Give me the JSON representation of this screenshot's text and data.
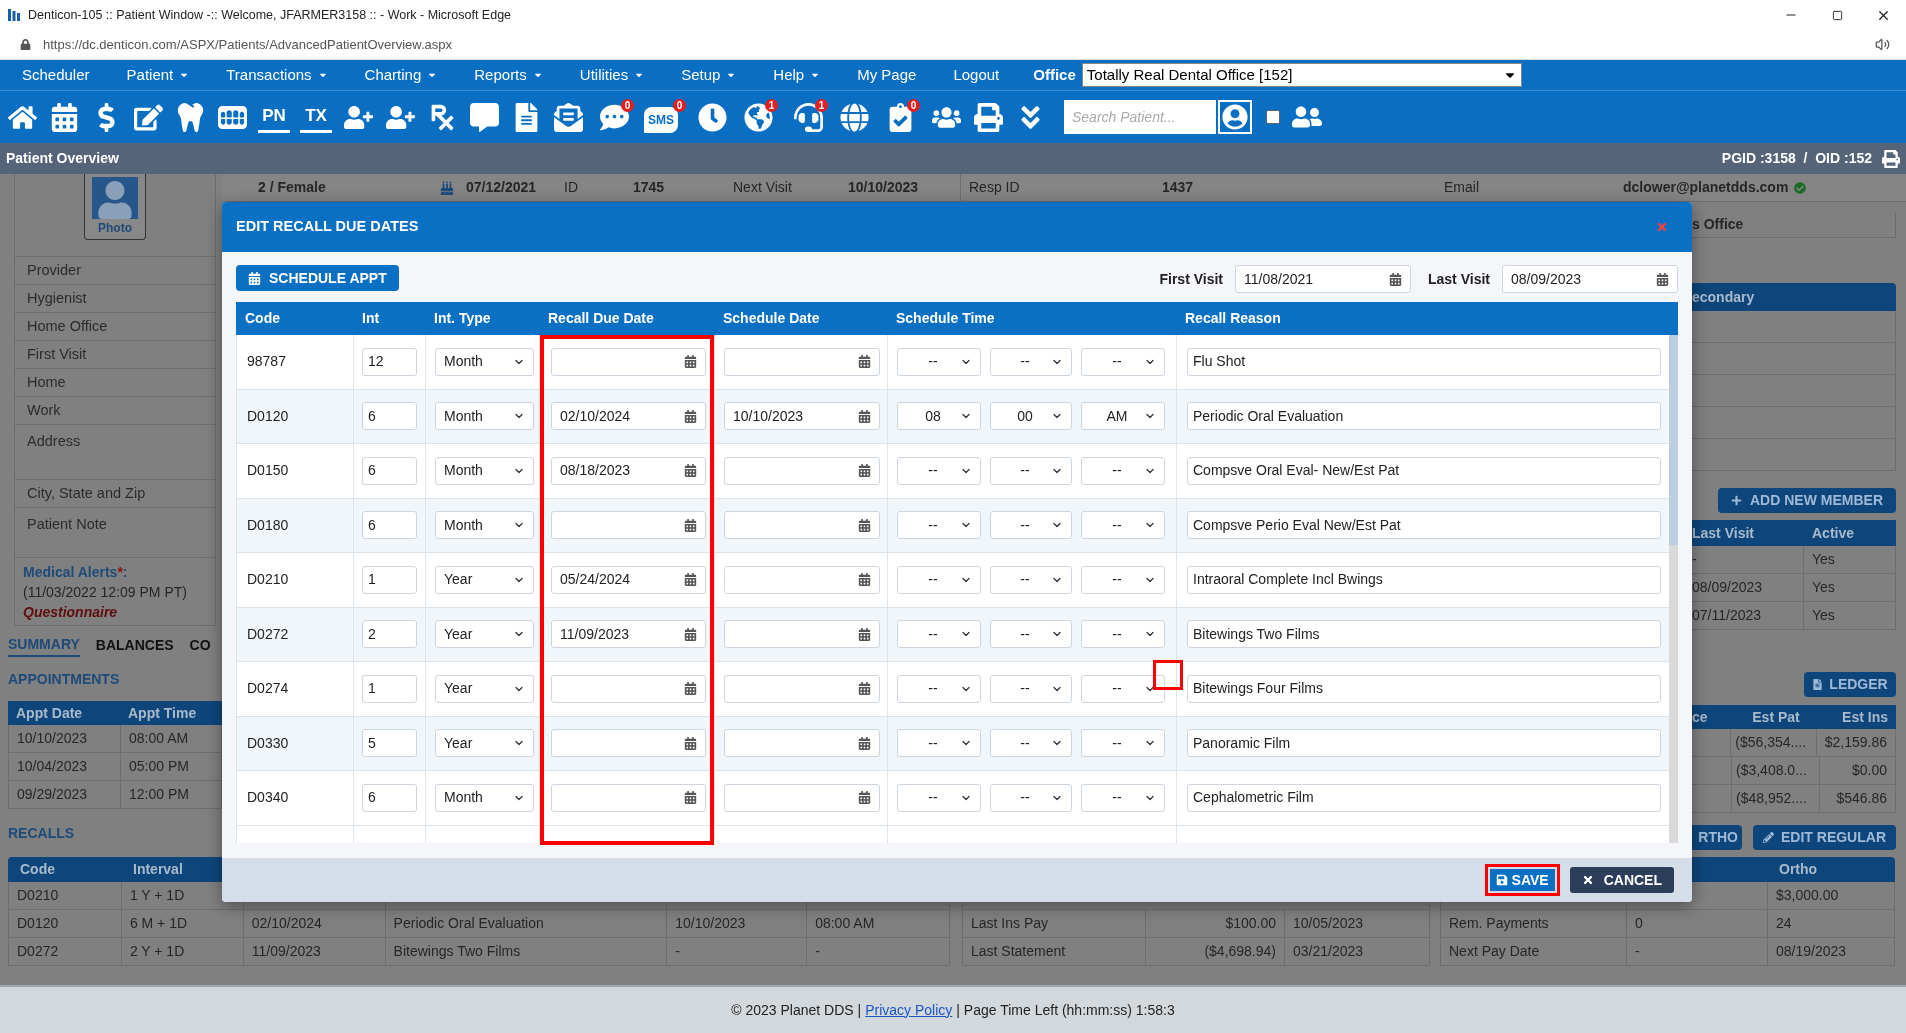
{
  "browser": {
    "title": "Denticon-105 :: Patient Window -:: Welcome, JFARMER3158 :: - Work - Microsoft Edge",
    "url": "https://dc.denticon.com/ASPX/Patients/AdvancedPatientOverview.aspx"
  },
  "menu": {
    "items": [
      {
        "label": "Scheduler",
        "dropdown": false
      },
      {
        "label": "Patient",
        "dropdown": true
      },
      {
        "label": "Transactions",
        "dropdown": true
      },
      {
        "label": "Charting",
        "dropdown": true
      },
      {
        "label": "Reports",
        "dropdown": true
      },
      {
        "label": "Utilities",
        "dropdown": true
      },
      {
        "label": "Setup",
        "dropdown": true
      },
      {
        "label": "Help",
        "dropdown": true
      },
      {
        "label": "My Page",
        "dropdown": false
      },
      {
        "label": "Logout",
        "dropdown": false
      }
    ],
    "office_label": "Office",
    "office_value": "Totally Real Dental Office [152]"
  },
  "toolbar": {
    "items": [
      {
        "kind": "icon"
      },
      {
        "kind": "icon"
      },
      {
        "kind": "icon"
      },
      {
        "kind": "icon"
      },
      {
        "kind": "icon"
      },
      {
        "kind": "icon"
      },
      {
        "kind": "text",
        "label": "PN"
      },
      {
        "kind": "text",
        "label": "TX"
      },
      {
        "kind": "icon"
      },
      {
        "kind": "icon"
      },
      {
        "kind": "icon"
      },
      {
        "kind": "icon"
      },
      {
        "kind": "icon"
      },
      {
        "kind": "icon"
      },
      {
        "kind": "icon",
        "badge": "0"
      },
      {
        "kind": "bubble",
        "label": "SMS",
        "badge": "0"
      },
      {
        "kind": "icon"
      },
      {
        "kind": "icon",
        "badge": "1"
      },
      {
        "kind": "icon",
        "badge": "1"
      },
      {
        "kind": "icon"
      },
      {
        "kind": "icon",
        "badge": "0"
      },
      {
        "kind": "icon"
      },
      {
        "kind": "icon"
      },
      {
        "kind": "icon"
      }
    ],
    "search_placeholder": "Search Patient...",
    "checkbox": {
      "checked": false
    }
  },
  "page_bar": {
    "title": "Patient Overview",
    "ids": "PGID :3158  /  OID :152"
  },
  "patient": {
    "photo_label": "Photo",
    "fields": [
      "Provider",
      "Hygienist",
      "Home Office",
      "First Visit",
      "Home",
      "Work",
      "Address",
      "City, State and Zip",
      "Patient Note"
    ],
    "medical_alerts": {
      "label": "Medical Alerts",
      "mark": "*",
      "end": ":",
      "date": "(11/03/2022 12:09 PM PT)",
      "link": "Questionnaire"
    },
    "tabs": [
      {
        "label": "SUMMARY",
        "selected": true
      },
      {
        "label": "BALANCES",
        "selected": false
      },
      {
        "label": "CO",
        "selected": false
      }
    ],
    "appointments": {
      "title": "APPOINTMENTS",
      "columns": [
        "Appt Date",
        "Appt Time"
      ],
      "rows": [
        [
          "10/10/2023",
          "08:00 AM"
        ],
        [
          "10/04/2023",
          "05:00 PM"
        ],
        [
          "09/29/2023",
          "12:00 PM"
        ]
      ]
    },
    "recalls_title": "RECALLS"
  },
  "header_strip": {
    "gender": "2 / Female",
    "birth_date": "07/12/2021",
    "id_label": "ID",
    "id": "1745",
    "next_visit_label": "Next Visit",
    "next_visit": "10/10/2023",
    "resp_id_label": "Resp ID",
    "resp_id": "1437",
    "email_label": "Email",
    "email": "dclower@planetdds.com"
  },
  "right_panel": {
    "office_fragment": "s Office",
    "insurance_header": "econdary",
    "add_member": "ADD NEW MEMBER",
    "family": {
      "columns": [
        "Last Visit",
        "Active"
      ],
      "rows": [
        [
          "-",
          "Yes"
        ],
        [
          "08/09/2023",
          "Yes"
        ],
        [
          "07/11/2023",
          "Yes"
        ]
      ]
    },
    "ledger": "LEDGER",
    "estimates": {
      "columns": [
        "ce",
        "Est Pat",
        "Est Ins"
      ],
      "rows": [
        [
          "",
          "($56,354....",
          "$2,159.86"
        ],
        [
          "",
          "($3,408.0...",
          "$0.00"
        ],
        [
          "",
          "($48,952....",
          "$546.86"
        ]
      ]
    },
    "ortho_button": "RTHO",
    "edit_regular": "EDIT REGULAR"
  },
  "recalls_table": {
    "columns": [
      "Code",
      "Interval"
    ],
    "rows": [
      [
        "D0210",
        "1 Y + 1D"
      ],
      [
        "D0120",
        "6 M + 1D",
        "02/10/2024",
        "Periodic Oral Evaluation",
        "10/10/2023",
        "08:00 AM"
      ],
      [
        "D0272",
        "2 Y + 1D",
        "11/09/2023",
        "Bitewings Two Films",
        "-",
        "-"
      ]
    ]
  },
  "balances": {
    "rows": [
      [
        "Last Ins Pay",
        "$100.00",
        "10/05/2023"
      ],
      [
        "Last Statement",
        "($4,698.94)",
        "03/21/2023"
      ]
    ]
  },
  "ortho": {
    "header": "Ortho",
    "total": "$3,000.00",
    "rows": [
      [
        "Rem. Payments",
        "0",
        "24"
      ],
      [
        "Next Pay Date",
        "-",
        "08/19/2023"
      ]
    ]
  },
  "modal": {
    "title": "EDIT RECALL DUE DATES",
    "schedule_button": "SCHEDULE APPT",
    "first_visit_label": "First Visit",
    "first_visit": "11/08/2021",
    "last_visit_label": "Last Visit",
    "last_visit": "08/09/2023",
    "columns": [
      "Code",
      "Int",
      "Int. Type",
      "Recall Due Date",
      "Schedule Date",
      "Schedule Time",
      "Recall Reason"
    ],
    "rows": [
      {
        "code": "98787",
        "int": "12",
        "int_type": "Month",
        "hour": "--",
        "minute": "--",
        "ampm": "--",
        "reason": "Flu Shot"
      },
      {
        "code": "D0120",
        "int": "6",
        "int_type": "Month",
        "due_date": "02/10/2024",
        "schedule_date": "10/10/2023",
        "hour": "08",
        "minute": "00",
        "ampm": "AM",
        "reason": "Periodic Oral Evaluation"
      },
      {
        "code": "D0150",
        "int": "6",
        "int_type": "Month",
        "due_date": "08/18/2023",
        "hour": "--",
        "minute": "--",
        "ampm": "--",
        "reason": "Compsve Oral Eval- New/Est Pat"
      },
      {
        "code": "D0180",
        "int": "6",
        "int_type": "Month",
        "hour": "--",
        "minute": "--",
        "ampm": "--",
        "reason": "Compsve Perio Eval New/Est Pat"
      },
      {
        "code": "D0210",
        "int": "1",
        "int_type": "Year",
        "due_date": "05/24/2024",
        "hour": "--",
        "minute": "--",
        "ampm": "--",
        "reason": "Intraoral Complete Incl Bwings"
      },
      {
        "code": "D0272",
        "int": "2",
        "int_type": "Year",
        "due_date": "11/09/2023",
        "hour": "--",
        "minute": "--",
        "ampm": "--",
        "reason": "Bitewings Two Films"
      },
      {
        "code": "D0274",
        "int": "1",
        "int_type": "Year",
        "hour": "--",
        "minute": "--",
        "ampm": "--",
        "reason": "Bitewings Four Films"
      },
      {
        "code": "D0330",
        "int": "5",
        "int_type": "Year",
        "hour": "--",
        "minute": "--",
        "ampm": "--",
        "reason": "Panoramic Film"
      },
      {
        "code": "D0340",
        "int": "6",
        "int_type": "Month",
        "hour": "--",
        "minute": "--",
        "ampm": "--",
        "reason": "Cephalometric Film"
      }
    ],
    "save": "SAVE",
    "cancel": "CANCEL"
  },
  "footer": {
    "copyright": "© 2023 Planet DDS |",
    "link": "Privacy Policy",
    "time_left": "| Page Time Left (hh:mm:ss) 1:58:3"
  }
}
